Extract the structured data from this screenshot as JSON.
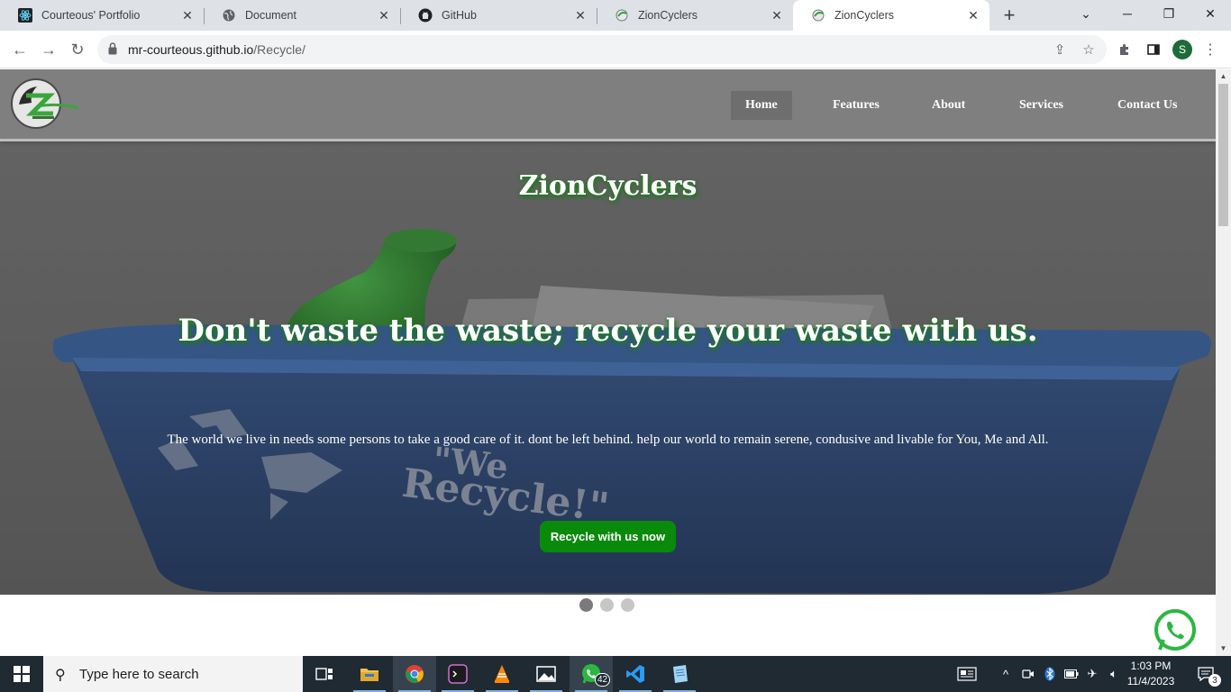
{
  "browser": {
    "tabs": [
      {
        "title": "Courteous' Portfolio",
        "icon": "react-icon"
      },
      {
        "title": "Document",
        "icon": "globe-icon"
      },
      {
        "title": "GitHub",
        "icon": "github-icon"
      },
      {
        "title": "ZionCyclers",
        "icon": "zioncyclers-favicon"
      },
      {
        "title": "ZionCyclers",
        "icon": "zioncyclers-favicon"
      }
    ],
    "active_tab": 4,
    "url_host": "mr-courteous.github.io",
    "url_path": "/Recycle/",
    "profile_initial": "S"
  },
  "site": {
    "nav": [
      {
        "label": "Home",
        "active": true
      },
      {
        "label": "Features",
        "active": false
      },
      {
        "label": "About",
        "active": false
      },
      {
        "label": "Services",
        "active": false
      },
      {
        "label": "Contact Us",
        "active": false
      }
    ],
    "hero": {
      "title": "ZionCyclers",
      "headline": "Don't waste the waste; recycle your waste with us.",
      "text": "The world we live in needs some persons to take a good care of it. dont be left behind. help our world to remain serene, condusive and livable for You, Me and All.",
      "cta": "Recycle with us now",
      "bin_text_line1": "\"We",
      "bin_text_line2": "Recycle!\""
    },
    "carousel": {
      "slides": 3,
      "active": 0
    },
    "colors": {
      "accent_green": "#0a8a0a",
      "shadow_green": "#1f7a1f",
      "nav_gray": "#808080"
    }
  },
  "taskbar": {
    "search_placeholder": "Type here to search",
    "apps": [
      "task-view-icon",
      "file-explorer-icon",
      "chrome-icon",
      "terminal-icon",
      "vlc-icon",
      "photos-icon",
      "whatsapp-icon",
      "vscode-icon",
      "notepad-icon"
    ],
    "whatsapp_badge": "42",
    "time": "1:03 PM",
    "date": "11/4/2023",
    "notifications": "3"
  }
}
